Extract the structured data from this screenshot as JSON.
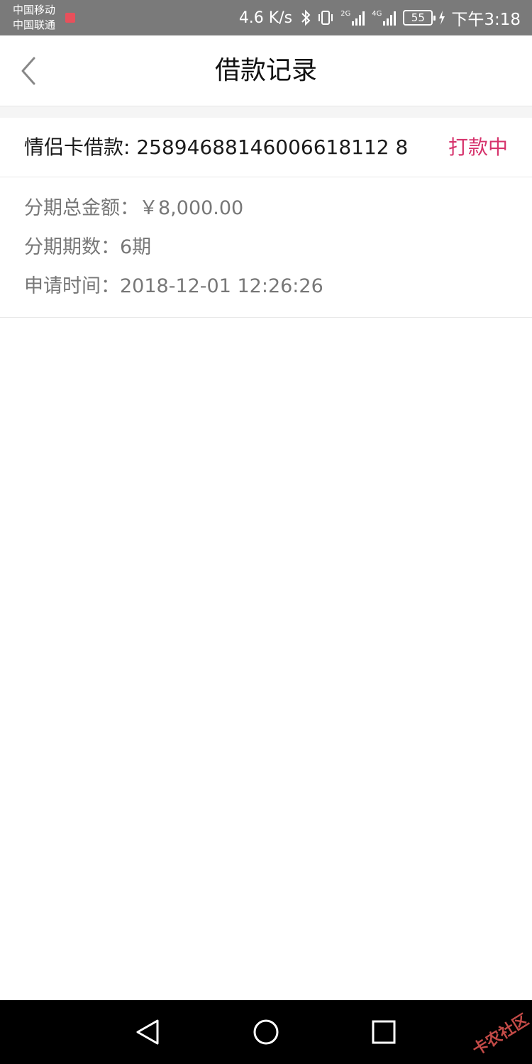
{
  "status_bar": {
    "carrier_1": "中国移动",
    "carrier_2": "中国联通",
    "speed": "4.6 K/s",
    "network_1": "2G",
    "network_2": "4G",
    "battery": "55",
    "time": "下午3:18"
  },
  "header": {
    "title": "借款记录",
    "back_icon": "chevron-left-icon"
  },
  "loan": {
    "title": "情侣卡借款: 25894688146006618112 8",
    "status": "打款中",
    "status_color": "#d6336c",
    "details": [
      {
        "label": "分期总金额：",
        "value": "￥8,000.00"
      },
      {
        "label": "分期期数：",
        "value": "6期"
      },
      {
        "label": "申请时间：",
        "value": "2018-12-01 12:26:26"
      }
    ]
  },
  "nav_bar": {
    "back_icon": "triangle-back-icon",
    "home_icon": "circle-home-icon",
    "recent_icon": "square-recent-icon",
    "watermark": "卡农社区"
  }
}
